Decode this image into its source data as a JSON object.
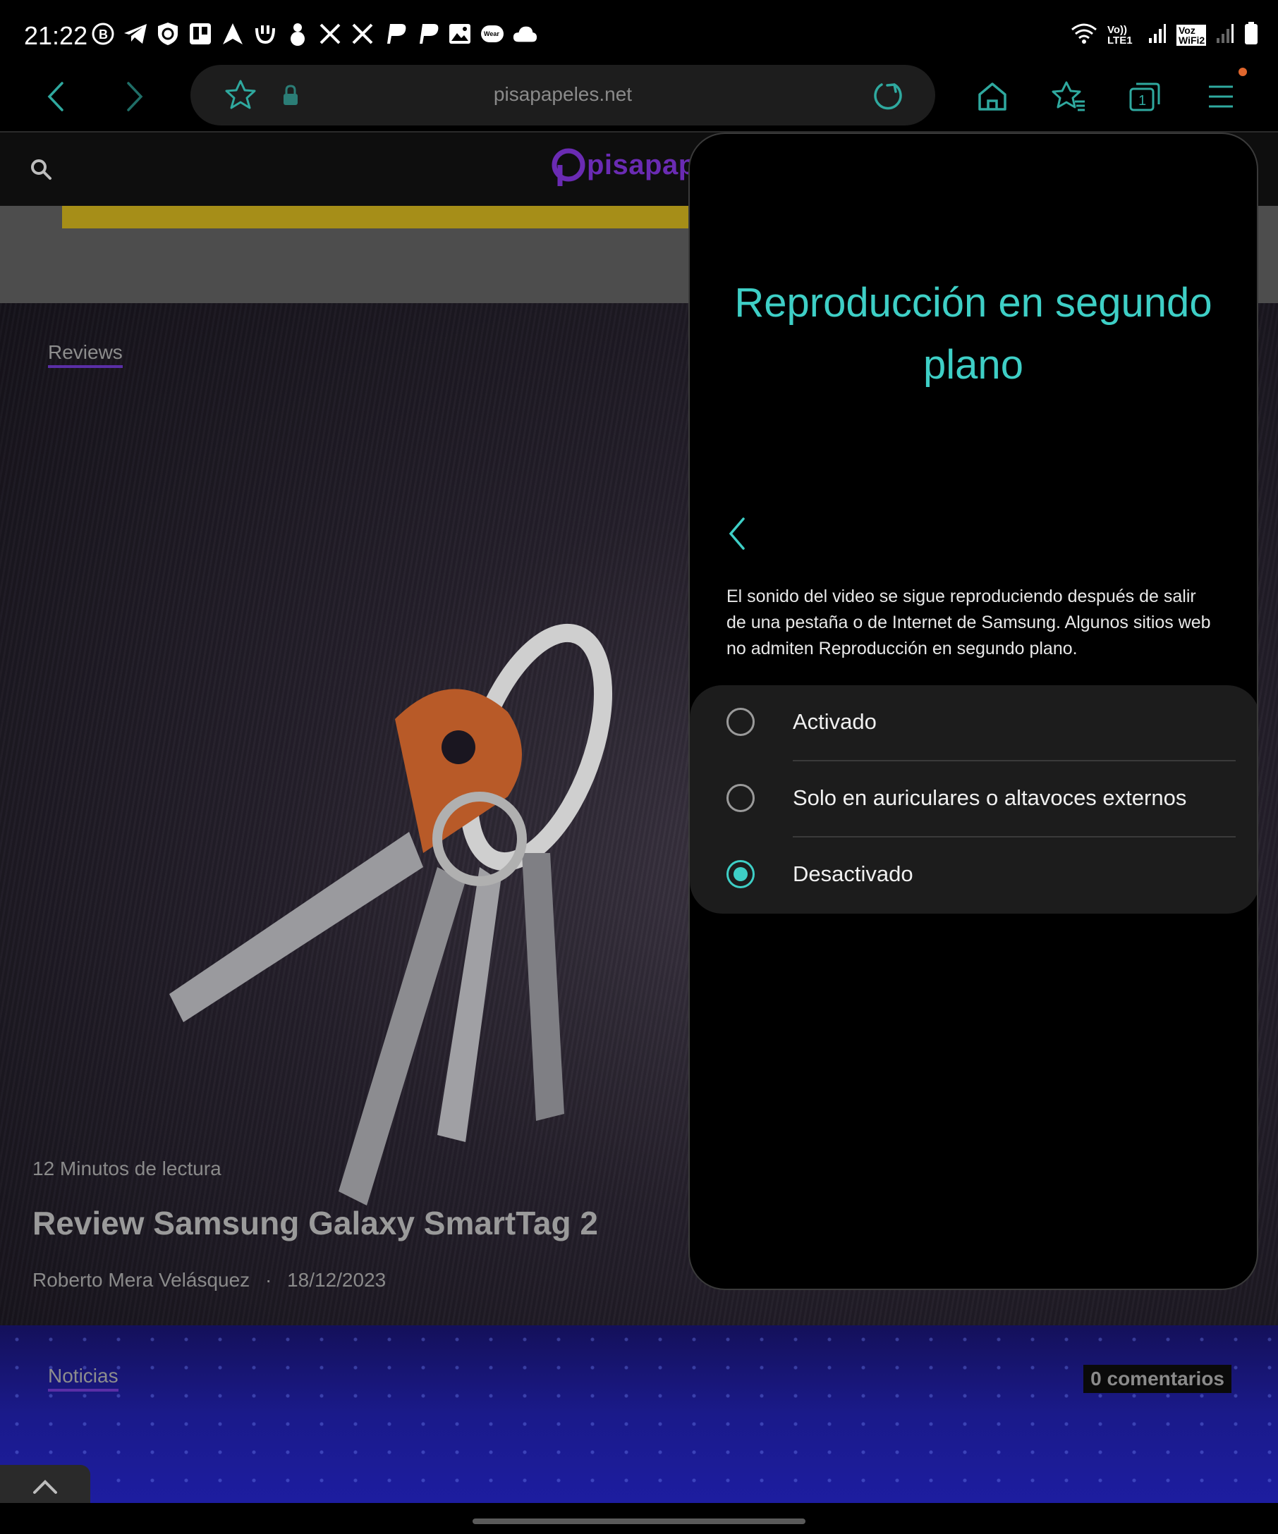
{
  "status_bar": {
    "time": "21:22",
    "left_icons": [
      "b-circle-icon",
      "telegram-icon",
      "shield-icon",
      "trello-icon",
      "navigation-icon",
      "mi-icon",
      "snowman-icon",
      "x-icon",
      "x-icon",
      "p-icon",
      "p-icon",
      "gallery-icon",
      "wear-icon",
      "cloud-icon"
    ],
    "right_icons": [
      "wifi6-icon",
      "volte-lte1-icon",
      "signal-icon",
      "voz-wifi2-icon",
      "signal-icon",
      "battery-icon"
    ],
    "wear_label": "Wear",
    "volte_label": "Vo)) LTE1",
    "vozwifi_label": "Voz WiFi2"
  },
  "browser": {
    "url": "pisapapeles.net",
    "accent": "#2fa99f"
  },
  "site": {
    "logo_text": "pisapape"
  },
  "article": {
    "category": "Reviews",
    "read_time": "12 Minutos de lectura",
    "title": "Review Samsung Galaxy SmartTag 2",
    "author": "Roberto Mera Velásquez",
    "separator": "·",
    "date": "18/12/2023"
  },
  "next_article": {
    "category": "Noticias",
    "comments": "0 comentarios"
  },
  "panel": {
    "title": "Reproducción en segundo plano",
    "description": "El sonido del video se sigue reproduciendo después de salir de una pestaña o de Internet de Samsung. Algunos sitios web no admiten Reproducción en segundo plano.",
    "options": [
      {
        "label": "Activado",
        "selected": false
      },
      {
        "label": "Solo en auriculares o altavoces externos",
        "selected": false
      },
      {
        "label": "Desactivado",
        "selected": true
      }
    ],
    "accent": "#3ecfc6"
  }
}
